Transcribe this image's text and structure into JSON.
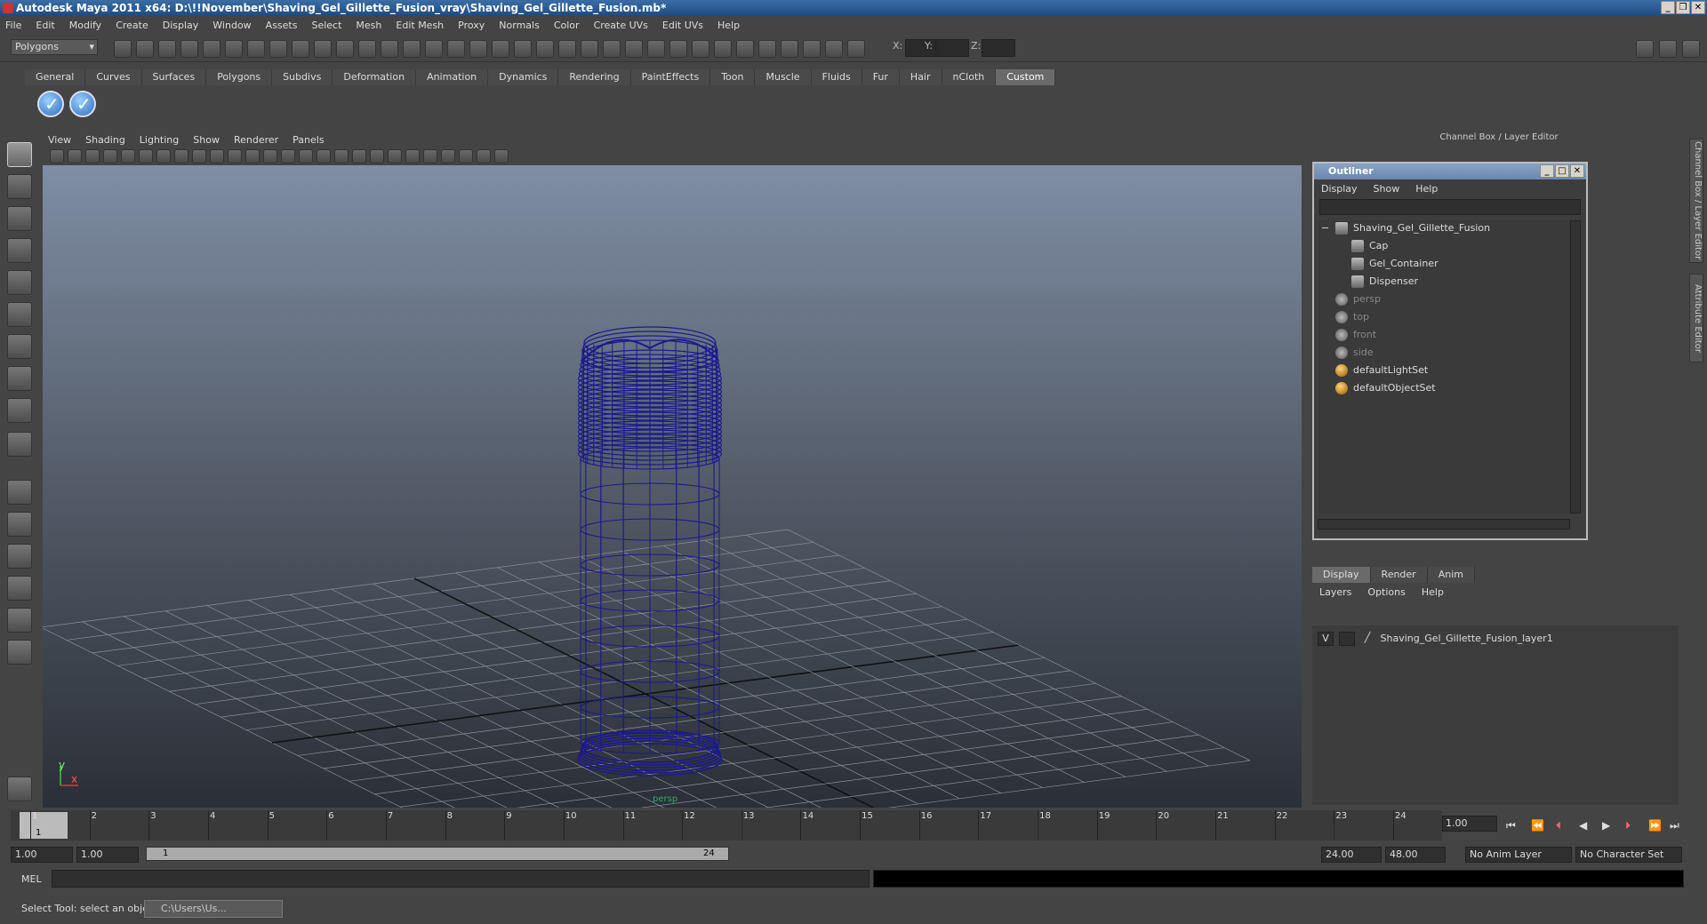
{
  "window": {
    "title": "Autodesk Maya 2011 x64: D:\\!!November\\Shaving_Gel_Gillette_Fusion_vray\\Shaving_Gel_Gillette_Fusion.mb*"
  },
  "menubar": [
    "File",
    "Edit",
    "Modify",
    "Create",
    "Display",
    "Window",
    "Assets",
    "Select",
    "Mesh",
    "Edit Mesh",
    "Proxy",
    "Normals",
    "Color",
    "Create UVs",
    "Edit UVs",
    "Help"
  ],
  "statusline": {
    "mode": "Polygons",
    "x_label": "X:",
    "y_label": "Y:",
    "z_label": "Z:"
  },
  "shelf": {
    "tabs": [
      "General",
      "Curves",
      "Surfaces",
      "Polygons",
      "Subdivs",
      "Deformation",
      "Animation",
      "Dynamics",
      "Rendering",
      "PaintEffects",
      "Toon",
      "Muscle",
      "Fluids",
      "Fur",
      "Hair",
      "nCloth",
      "Custom"
    ],
    "active_tab": "Custom"
  },
  "viewport": {
    "menu": [
      "View",
      "Shading",
      "Lighting",
      "Show",
      "Renderer",
      "Panels"
    ],
    "camera_label": "persp",
    "axis_y": "y",
    "axis_x": "x",
    "wire_color": "#1a1a8c"
  },
  "channel_box": {
    "title": "Channel Box / Layer Editor"
  },
  "outliner": {
    "title": "Outliner",
    "menu": [
      "Display",
      "Show",
      "Help"
    ],
    "items": [
      {
        "label": "Shaving_Gel_Gillette_Fusion",
        "indent": 0,
        "kind": "group",
        "dim": false,
        "expander": "−"
      },
      {
        "label": "Cap",
        "indent": 1,
        "kind": "mesh",
        "dim": false
      },
      {
        "label": "Gel_Container",
        "indent": 1,
        "kind": "mesh",
        "dim": false
      },
      {
        "label": "Dispenser",
        "indent": 1,
        "kind": "mesh",
        "dim": false
      },
      {
        "label": "persp",
        "indent": 0,
        "kind": "camera",
        "dim": true
      },
      {
        "label": "top",
        "indent": 0,
        "kind": "camera",
        "dim": true
      },
      {
        "label": "front",
        "indent": 0,
        "kind": "camera",
        "dim": true
      },
      {
        "label": "side",
        "indent": 0,
        "kind": "camera",
        "dim": true
      },
      {
        "label": "defaultLightSet",
        "indent": 0,
        "kind": "set",
        "dim": false
      },
      {
        "label": "defaultObjectSet",
        "indent": 0,
        "kind": "set",
        "dim": false
      }
    ]
  },
  "layer_editor": {
    "tabs": [
      "Display",
      "Render",
      "Anim"
    ],
    "active_tab": "Display",
    "menu": [
      "Layers",
      "Options",
      "Help"
    ],
    "layers": [
      {
        "visible": "V",
        "name": "Shaving_Gel_Gillette_Fusion_layer1"
      }
    ]
  },
  "side_tabs": [
    "Channel Box / Layer Editor",
    "Attribute Editor"
  ],
  "timeline": {
    "ticks": [
      1,
      2,
      3,
      4,
      5,
      6,
      7,
      8,
      9,
      10,
      11,
      12,
      13,
      14,
      15,
      16,
      17,
      18,
      19,
      20,
      21,
      22,
      23,
      24
    ],
    "current_frame": "1",
    "current_time_field": "1.00"
  },
  "range": {
    "start_time": "1.00",
    "playback_start": "1.00",
    "slider_start": "1",
    "slider_end": "24",
    "playback_end": "24.00",
    "end_time": "48.00",
    "anim_layer": "No Anim Layer",
    "character_set": "No Character Set"
  },
  "command": {
    "label": "MEL"
  },
  "status": {
    "help_text": "Select Tool: select an object",
    "task_button": "C:\\Users\\Us..."
  }
}
